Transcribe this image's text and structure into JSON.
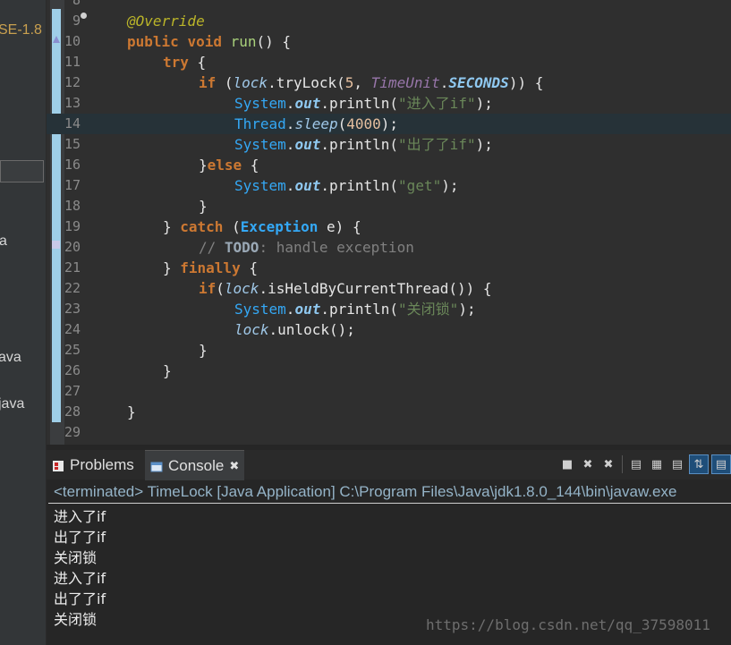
{
  "left_panel": {
    "items": [
      "SE-1.8",
      "a",
      "ava",
      "java"
    ]
  },
  "editor": {
    "lines": [
      {
        "n": "8"
      },
      {
        "n": "9"
      },
      {
        "n": "10"
      },
      {
        "n": "11"
      },
      {
        "n": "12"
      },
      {
        "n": "13"
      },
      {
        "n": "14"
      },
      {
        "n": "15"
      },
      {
        "n": "16"
      },
      {
        "n": "17"
      },
      {
        "n": "18"
      },
      {
        "n": "19"
      },
      {
        "n": "20"
      },
      {
        "n": "21"
      },
      {
        "n": "22"
      },
      {
        "n": "23"
      },
      {
        "n": "24"
      },
      {
        "n": "25"
      },
      {
        "n": "26"
      },
      {
        "n": "27"
      },
      {
        "n": "28"
      },
      {
        "n": "29"
      }
    ],
    "code": {
      "l9_annotation": "@Override",
      "l10_public": "public",
      "l10_void": "void",
      "l10_method": "run",
      "l10_rest": "() {",
      "l11_try": "try",
      "l11_rest": " {",
      "l12_if": "if",
      "l12_open": " (",
      "l12_lock": "lock",
      "l12_trylock": ".tryLock(",
      "l12_num": "5",
      "l12_comma": ", ",
      "l12_timeunit": "TimeUnit",
      "l12_dot": ".",
      "l12_seconds": "SECONDS",
      "l12_close": ")) {",
      "l13_system": "System",
      "l13_dot": ".",
      "l13_out": "out",
      "l13_println": ".println(",
      "l13_str": "\"进入了if\"",
      "l13_end": ");",
      "l14_thread": "Thread",
      "l14_dot": ".",
      "l14_sleep": "sleep",
      "l14_open": "(",
      "l14_num": "4000",
      "l14_end": ");",
      "l15_system": "System",
      "l15_dot": ".",
      "l15_out": "out",
      "l15_println": ".println(",
      "l15_str": "\"出了了if\"",
      "l15_end": ");",
      "l16_close": "}",
      "l16_else": "else",
      "l16_rest": " {",
      "l17_system": "System",
      "l17_dot": ".",
      "l17_out": "out",
      "l17_println": ".println(",
      "l17_str": "\"get\"",
      "l17_end": ");",
      "l18_close": "}",
      "l19_close": "} ",
      "l19_catch": "catch",
      "l19_open": " (",
      "l19_exception": "Exception",
      "l19_rest": " e) {",
      "l20_slashes": "// ",
      "l20_todo": "TODO",
      "l20_rest": ": handle exception",
      "l21_close": "} ",
      "l21_finally": "finally",
      "l21_rest": " {",
      "l22_if": "if",
      "l22_open": "(",
      "l22_lock": "lock",
      "l22_held": ".isHeldByCurrentThread()) {",
      "l23_system": "System",
      "l23_dot": ".",
      "l23_out": "out",
      "l23_println": ".println(",
      "l23_str": "\"关闭锁\"",
      "l23_end": ");",
      "l24_lock": "lock",
      "l24_unlock": ".unlock();",
      "l25_close": "}",
      "l26_close": "}",
      "l28_close": "}"
    }
  },
  "console": {
    "tabs": {
      "problems": "Problems",
      "console": "Console",
      "close": "✖"
    },
    "toolbar": [
      "■",
      "✖",
      "✖",
      "▤",
      "▦",
      "▤",
      "⇅",
      "▤"
    ],
    "header": "<terminated> TimeLock [Java Application] C:\\Program Files\\Java\\jdk1.8.0_144\\bin\\javaw.exe",
    "output": [
      "进入了if",
      "出了了if",
      "关闭锁",
      "进入了if",
      "出了了if",
      "关闭锁"
    ]
  },
  "watermark": "https://blog.csdn.net/qq_37598011",
  "colors": {
    "gutter_bar": "#9fcfe8",
    "keyword": "#cc7832",
    "annotation": "#bbb529",
    "string": "#6a8759",
    "console_header": "#95b4c8"
  }
}
